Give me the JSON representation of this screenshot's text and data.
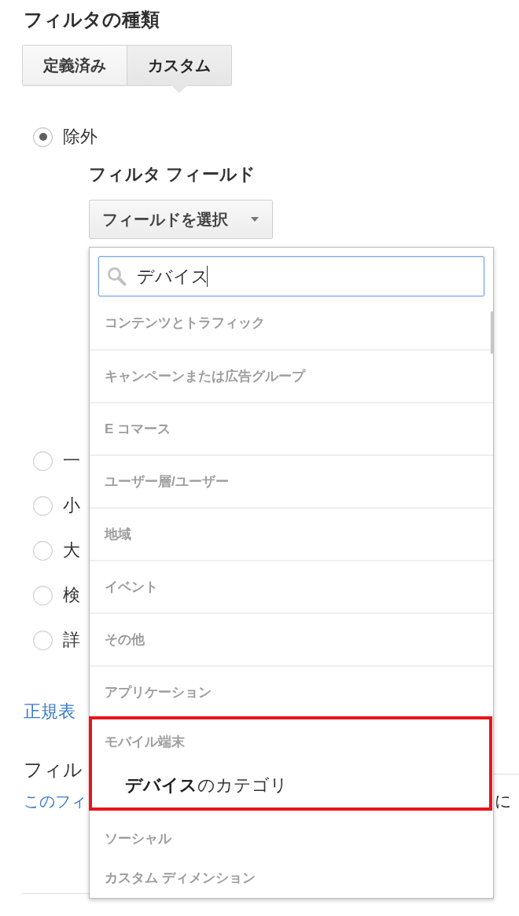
{
  "filter_type": {
    "title": "フィルタの種類",
    "tabs": [
      {
        "label": "定義済み",
        "selected": false
      },
      {
        "label": "カスタム",
        "selected": true
      }
    ]
  },
  "filter_kinds": [
    {
      "label": "除外",
      "selected": true
    },
    {
      "label": "一",
      "selected": false
    },
    {
      "label": "小",
      "selected": false
    },
    {
      "label": "大",
      "selected": false
    },
    {
      "label": "検",
      "selected": false
    },
    {
      "label": "詳",
      "selected": false
    }
  ],
  "filter_field": {
    "label": "フィルタ フィールド",
    "button": "フィールドを選択"
  },
  "field_menu": {
    "search": {
      "value": "デバイス"
    },
    "groups": [
      {
        "header": "コンテンツとトラフィック",
        "highlighted": false
      },
      {
        "header": "キャンペーンまたは広告グループ",
        "highlighted": false
      },
      {
        "header": "E コマース",
        "highlighted": false
      },
      {
        "header": "ユーザー層/ユーザー",
        "highlighted": false
      },
      {
        "header": "地域",
        "highlighted": false
      },
      {
        "header": "イベント",
        "highlighted": false
      },
      {
        "header": "その他",
        "highlighted": false
      },
      {
        "header": "アプリケーション",
        "highlighted": false
      },
      {
        "header": "モバイル端末",
        "highlighted": true,
        "options": [
          {
            "label": "**デバイス**のカテゴリ"
          }
        ]
      },
      {
        "header": "ソーシャル",
        "highlighted": false
      },
      {
        "header": "カスタム ディメンション",
        "highlighted": false
      }
    ]
  },
  "regex_link": "正規表",
  "section_2": {
    "title": "フィル",
    "link": "このフィ",
    "text": "に"
  }
}
